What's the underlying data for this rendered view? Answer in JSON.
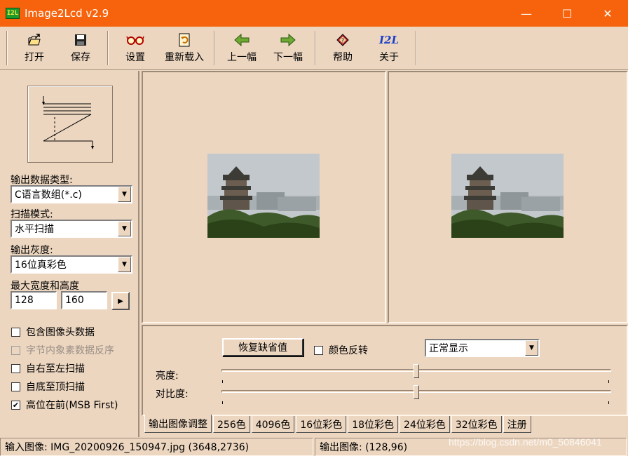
{
  "window": {
    "icon_text": "I2L",
    "title": "Image2Lcd v2.9",
    "minimize": "—",
    "maximize": "☐",
    "close": "✕"
  },
  "toolbar": {
    "open": "打开",
    "save": "保存",
    "settings": "设置",
    "reload": "重新载入",
    "prev": "上一幅",
    "next": "下一幅",
    "help": "帮助",
    "about": "关于",
    "about_icon_text": "I2L"
  },
  "left": {
    "output_type_label": "输出数据类型:",
    "output_type_value": "C语言数组(*.c)",
    "scan_mode_label": "扫描模式:",
    "scan_mode_value": "水平扫描",
    "gray_label": "输出灰度:",
    "gray_value": "16位真彩色",
    "size_label": "最大宽度和高度",
    "max_width": "128",
    "max_height": "160",
    "options": [
      {
        "label": "包含图像头数据",
        "checked": false,
        "disabled": false
      },
      {
        "label": "字节内象素数据反序",
        "checked": false,
        "disabled": true
      },
      {
        "label": "自右至左扫描",
        "checked": false,
        "disabled": false
      },
      {
        "label": "自底至顶扫描",
        "checked": false,
        "disabled": false
      },
      {
        "label": "高位在前(MSB First)",
        "checked": true,
        "disabled": false
      }
    ]
  },
  "adjust": {
    "restore_defaults": "恢复缺省值",
    "invert_label": "颜色反转",
    "invert_checked": false,
    "display_mode": "正常显示",
    "brightness_label": "亮度:",
    "contrast_label": "对比度:",
    "brightness_level": 0.5,
    "contrast_level": 0.5
  },
  "tabs": [
    "输出图像调整",
    "256色",
    "4096色",
    "16位彩色",
    "18位彩色",
    "24位彩色",
    "32位彩色",
    "注册"
  ],
  "status": {
    "input": "输入图像:  IMG_20200926_150947.jpg (3648,2736)",
    "output": "输出图像:  (128,96)"
  },
  "watermark": "https://blog.csdn.net/m0_50846041",
  "colors": {
    "titlebar": "#f7630c",
    "background": "#ecd6c0"
  }
}
